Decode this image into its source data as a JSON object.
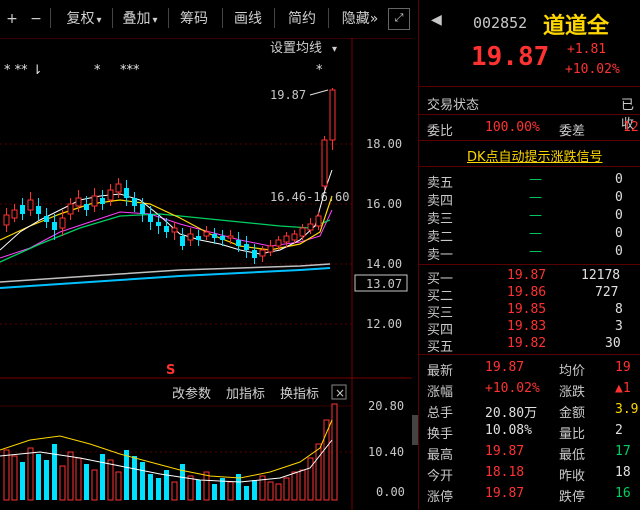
{
  "toolbar": {
    "plus": "+",
    "minus": "−",
    "fuquan": "复权",
    "diejia": "叠加",
    "chouma": "筹码",
    "huaxian": "画线",
    "jianyue": "简约",
    "yincang": "隐藏",
    "expand": "»"
  },
  "chart": {
    "settings_label": "设置均线",
    "price_annot_high": "19.87",
    "price_annot_range": "16.46-16.60",
    "stars_1": "*  **  ⇂",
    "stars_2": "*",
    "stars_3": "***",
    "stars_4": "*",
    "signal_mark": "S",
    "price_axis": [
      "18.00",
      "16.00",
      "14.00",
      "13.07",
      "12.00"
    ],
    "current_price_box": "13.07",
    "indicator_buttons": [
      "改参数",
      "加指标",
      "换指标"
    ],
    "indicator_close": "×",
    "vol_axis": [
      "20.80",
      "10.40",
      "0.00"
    ]
  },
  "stock": {
    "code": "002852",
    "name": "道道全",
    "price": "19.87",
    "change": "+1.81",
    "change_pct": "+10.02%"
  },
  "panel": {
    "trade_status_label": "交易状态",
    "trade_status_value": "已收",
    "weibi_label": "委比",
    "weibi_value": "100.00%",
    "weicha_label": "委差",
    "weicha_value": "12",
    "signal_link": "DK点自动提示涨跌信号",
    "sell": [
      {
        "label": "卖五",
        "price": "—",
        "vol": "0"
      },
      {
        "label": "卖四",
        "price": "—",
        "vol": "0"
      },
      {
        "label": "卖三",
        "price": "—",
        "vol": "0"
      },
      {
        "label": "卖二",
        "price": "—",
        "vol": "0"
      },
      {
        "label": "卖一",
        "price": "—",
        "vol": "0"
      }
    ],
    "buy": [
      {
        "label": "买一",
        "price": "19.87",
        "vol": "12178"
      },
      {
        "label": "买二",
        "price": "19.86",
        "vol": "727"
      },
      {
        "label": "买三",
        "price": "19.85",
        "vol": "8"
      },
      {
        "label": "买四",
        "price": "19.83",
        "vol": "3"
      },
      {
        "label": "买五",
        "price": "19.82",
        "vol": "30"
      }
    ],
    "stats": [
      {
        "l1": "最新",
        "v1": "19.87",
        "l2": "均价",
        "v2": "19"
      },
      {
        "l1": "涨幅",
        "v1": "+10.02%",
        "l2": "涨跌",
        "v2": "▲1"
      },
      {
        "l1": "总手",
        "v1": "20.80万",
        "l2": "金额",
        "v2": "3.9"
      },
      {
        "l1": "换手",
        "v1": "10.08%",
        "l2": "量比",
        "v2": "2"
      },
      {
        "l1": "最高",
        "v1": "19.87",
        "l2": "最低",
        "v2": "17"
      },
      {
        "l1": "今开",
        "v1": "18.18",
        "l2": "昨收",
        "v2": "18"
      },
      {
        "l1": "涨停",
        "v1": "19.87",
        "l2": "跌停",
        "v2": "16"
      }
    ]
  },
  "colors": {
    "up": "#ff3232",
    "down": "#00e0ff",
    "ma5": "#ffffff",
    "ma10": "#ffd700",
    "ma20": "#ff40ff",
    "ma30": "#00d060",
    "ma60": "#c0c0c0",
    "ma120": "#00c0ff"
  }
}
